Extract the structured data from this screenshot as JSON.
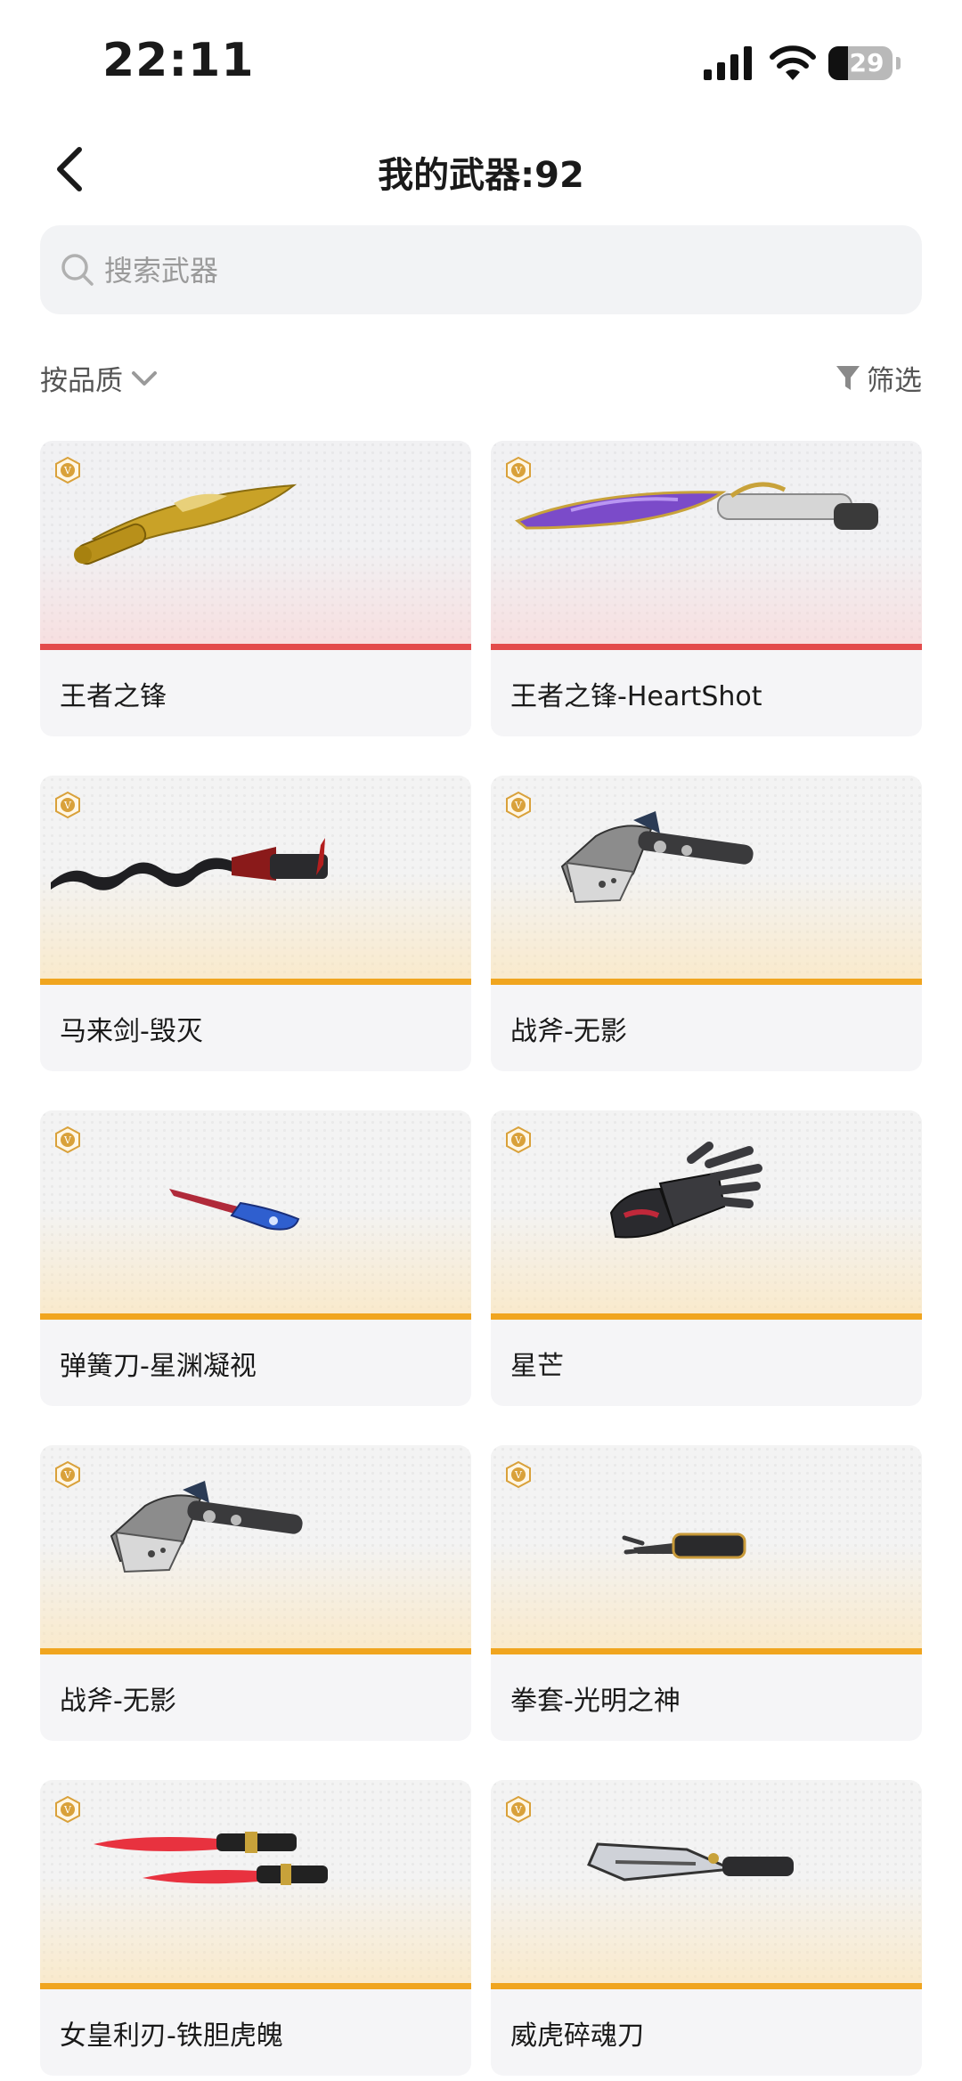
{
  "status_bar": {
    "time": "22:11",
    "battery": "29"
  },
  "header": {
    "title": "我的武器:92"
  },
  "search": {
    "placeholder": "搜索武器"
  },
  "toolbar": {
    "sort_label": "按品质",
    "filter_label": "筛选"
  },
  "colors": {
    "red_tier": "#e34b4b",
    "gold_tier": "#f0a51f",
    "badge": "#d9a13a"
  },
  "weapons": [
    {
      "name": "王者之锋",
      "tier": "red",
      "badge_icon": "v-badge-icon",
      "image": "golden-dragon-kukri-icon"
    },
    {
      "name": "王者之锋-HeartShot",
      "tier": "red",
      "badge_icon": "v-badge-icon",
      "image": "purple-kukri-icon"
    },
    {
      "name": "马来剑-毁灭",
      "tier": "gold",
      "badge_icon": "v-badge-icon",
      "image": "wavy-kris-sword-icon"
    },
    {
      "name": "战斧-无影",
      "tier": "gold",
      "badge_icon": "v-badge-icon",
      "image": "battle-axe-icon"
    },
    {
      "name": "弹簧刀-星渊凝视",
      "tier": "gold",
      "badge_icon": "v-badge-icon",
      "image": "switchblade-icon"
    },
    {
      "name": "星芒",
      "tier": "gold",
      "badge_icon": "v-badge-icon",
      "image": "gauntlet-icon"
    },
    {
      "name": "战斧-无影",
      "tier": "gold",
      "badge_icon": "v-badge-icon",
      "image": "battle-axe-icon"
    },
    {
      "name": "拳套-光明之神",
      "tier": "gold",
      "badge_icon": "v-badge-icon",
      "image": "knuckle-glove-icon"
    },
    {
      "name": "女皇利刃-铁胆虎魄",
      "tier": "gold",
      "badge_icon": "v-badge-icon",
      "image": "twin-red-blades-icon"
    },
    {
      "name": "威虎碎魂刀",
      "tier": "gold",
      "badge_icon": "v-badge-icon",
      "image": "cleaver-blade-icon"
    }
  ]
}
